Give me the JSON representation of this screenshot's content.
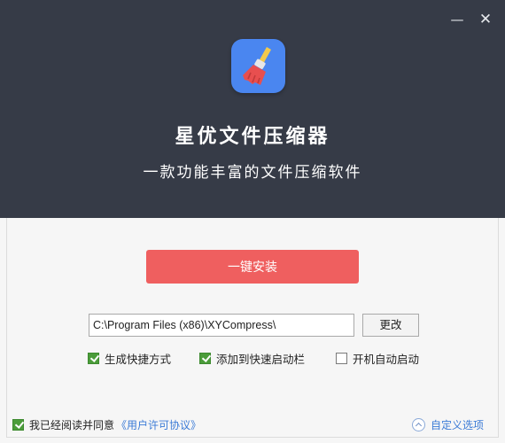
{
  "window": {
    "minimize_glyph": "—",
    "close_glyph": "✕"
  },
  "header": {
    "app_icon": "broom-icon",
    "title": "星优文件压缩器",
    "subtitle": "一款功能丰富的文件压缩软件",
    "background_color": "#363b47",
    "icon_color": "#4a86f0"
  },
  "install": {
    "button_label": "一键安装",
    "button_color": "#ef5f5f",
    "path_value": "C:\\Program Files (x86)\\XYCompress\\",
    "change_label": "更改"
  },
  "options": [
    {
      "label": "生成快捷方式",
      "checked": true
    },
    {
      "label": "添加到快速启动栏",
      "checked": true
    },
    {
      "label": "开机自动启动",
      "checked": false
    }
  ],
  "footer": {
    "agree_text": "我已经阅读并同意",
    "license_link": "《用户许可协议》",
    "agree_checked": true,
    "custom_options_label": "自定义选项",
    "custom_options_icon": "chevron-up-icon",
    "link_color": "#3b7bd6"
  }
}
